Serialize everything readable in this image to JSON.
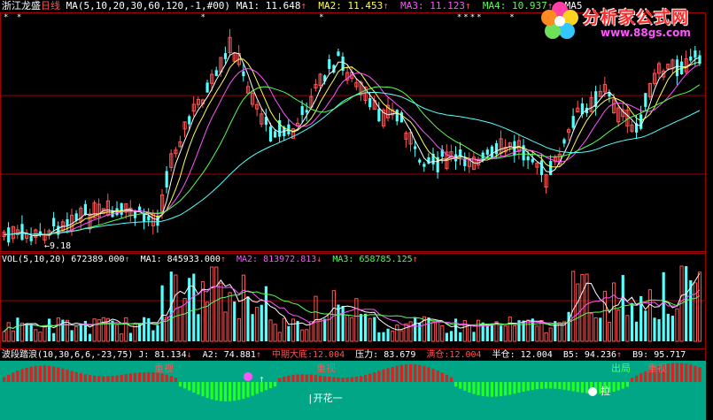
{
  "stock": {
    "name": "浙江龙盛",
    "period": "日线"
  },
  "price_header": {
    "ma_params": "MA(5,10,20,30,60,120,-1,#00)",
    "ma1": "MA1: 11.648",
    "ma2": "MA2: 11.453",
    "ma3": "MA3: 11.123",
    "ma4": "MA4: 10.937",
    "ma5": "MA5"
  },
  "low_marker": "9.18",
  "vol_header": {
    "params": "VOL(5,10,20)",
    "vol": "672389.000",
    "ma1": "MA1: 845933.000",
    "ma2": "MA2: 813972.813",
    "ma3": "MA3: 658785.125"
  },
  "ind_header": {
    "name": "波段踏浪",
    "params": "(10,30,6,6,-23,75)",
    "j": "J: 81.134",
    "a2": "A2: 74.881",
    "dd_label": "中期大底:",
    "dd_val": "12.004",
    "yl": "压力: 83.679",
    "mc_label": "满仓:",
    "mc_val": "12.004",
    "bc": "半仓: 12.004",
    "b5": "B5: 94.236",
    "b9": "B9: 95.717"
  },
  "ind_labels": {
    "focus": "重视",
    "kaihua": "开花一",
    "la": "拉",
    "out": "出局",
    "arrow": "↑"
  },
  "logo": {
    "text": "分析家公式网",
    "url": "www.88gs.com"
  },
  "colors": {
    "up": "#ff5454",
    "down": "#54ffff",
    "ma1": "#ffffff",
    "ma2": "#ffff54",
    "ma3": "#ff55ff",
    "ma4": "#54ff54",
    "ind_bg": "#00a685"
  },
  "chart_data": {
    "type": "candlestick",
    "series": [
      {
        "name": "MA1"
      },
      {
        "name": "MA2"
      },
      {
        "name": "MA3"
      },
      {
        "name": "MA4"
      }
    ]
  }
}
